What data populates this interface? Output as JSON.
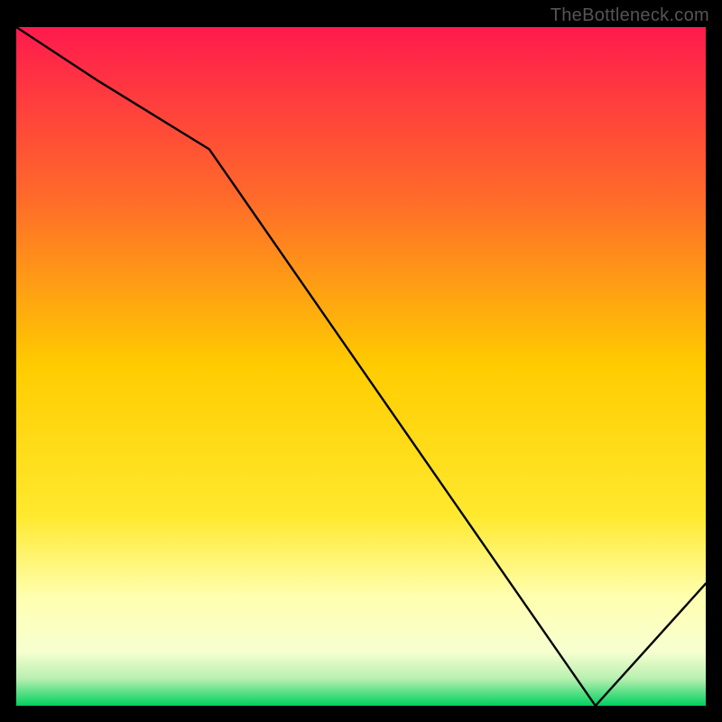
{
  "watermark": "TheBottleneck.com",
  "chart_data": {
    "type": "line",
    "x": [
      0,
      12,
      28,
      84,
      100
    ],
    "y": [
      100,
      92,
      82,
      0,
      18
    ],
    "xlim": [
      0,
      100
    ],
    "ylim": [
      0,
      100
    ],
    "xlabel": "",
    "ylabel": "",
    "title": "",
    "minimum_marker_x": 84,
    "minimum_marker_label": "",
    "grid": false,
    "background_gradient": {
      "top": "#ff1a4d",
      "mid": "#ffd400",
      "low": "#ffff99",
      "bottom": "#00d060"
    },
    "line_color": "#000000"
  }
}
